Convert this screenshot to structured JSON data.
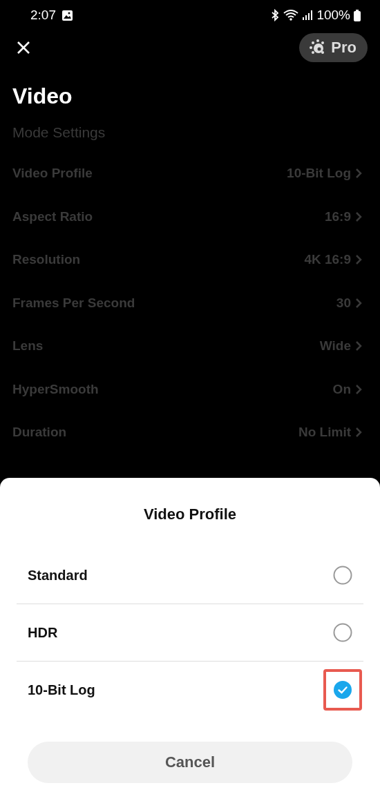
{
  "status_bar": {
    "time": "2:07",
    "battery": "100%"
  },
  "top_bar": {
    "pro_label": "Pro"
  },
  "title": "Video",
  "section": {
    "label": "Mode Settings",
    "rows": [
      {
        "label": "Video Profile",
        "value": "10-Bit Log"
      },
      {
        "label": "Aspect Ratio",
        "value": "16:9"
      },
      {
        "label": "Resolution",
        "value": "4K 16:9"
      },
      {
        "label": "Frames Per Second",
        "value": "30"
      },
      {
        "label": "Lens",
        "value": "Wide"
      },
      {
        "label": "HyperSmooth",
        "value": "On"
      },
      {
        "label": "Duration",
        "value": "No Limit"
      }
    ]
  },
  "sheet": {
    "title": "Video Profile",
    "options": [
      {
        "label": "Standard",
        "selected": false,
        "highlighted": false
      },
      {
        "label": "HDR",
        "selected": false,
        "highlighted": false
      },
      {
        "label": "10-Bit Log",
        "selected": true,
        "highlighted": true
      }
    ],
    "cancel": "Cancel"
  }
}
